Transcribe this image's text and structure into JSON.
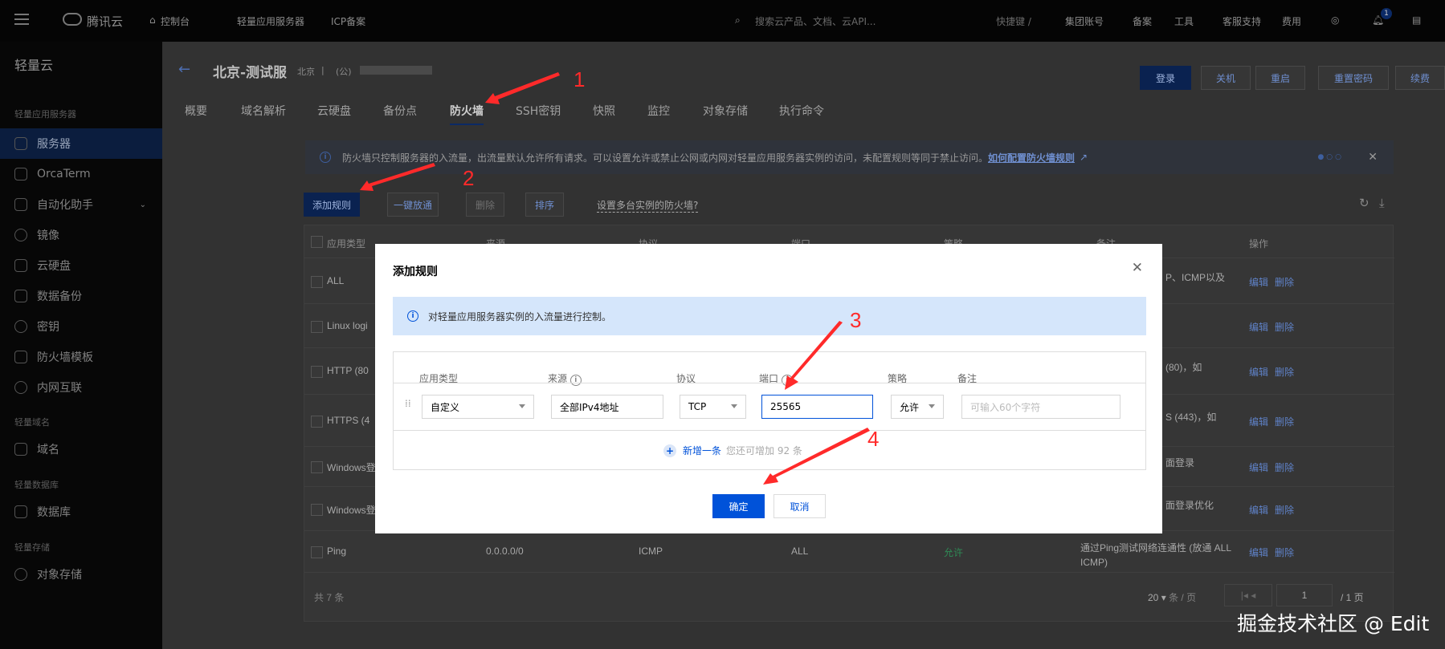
{
  "topbar": {
    "brand": "腾讯云",
    "console": "控制台",
    "nav": [
      "轻量应用服务器",
      "ICP备案"
    ],
    "search_placeholder": "搜索云产品、文档、云API...",
    "shortcut": "快捷键 /",
    "right": [
      "集团账号",
      "备案",
      "工具",
      "客服支持",
      "费用"
    ],
    "notif_count": "1"
  },
  "sidebar": {
    "title": "轻量云",
    "sections": [
      {
        "label": "轻量应用服务器",
        "items": [
          {
            "label": "服务器",
            "active": true
          },
          {
            "label": "OrcaTerm"
          },
          {
            "label": "自动化助手"
          },
          {
            "label": "镜像"
          },
          {
            "label": "云硬盘"
          },
          {
            "label": "数据备份"
          },
          {
            "label": "密钥"
          },
          {
            "label": "防火墙模板"
          },
          {
            "label": "内网互联"
          }
        ]
      },
      {
        "label": "轻量域名",
        "items": [
          {
            "label": "域名"
          }
        ]
      },
      {
        "label": "轻量数据库",
        "items": [
          {
            "label": "数据库"
          }
        ]
      },
      {
        "label": "轻量存储",
        "items": [
          {
            "label": "对象存储"
          }
        ]
      }
    ]
  },
  "header": {
    "title": "北京-测试服",
    "region": "北京",
    "ip_prefix": "(公)",
    "actions": [
      "登录",
      "关机",
      "重启",
      "重置密码",
      "续费"
    ]
  },
  "tabs": [
    "概要",
    "域名解析",
    "云硬盘",
    "备份点",
    "防火墙",
    "SSH密钥",
    "快照",
    "监控",
    "对象存储",
    "执行命令"
  ],
  "active_tab": "防火墙",
  "banner": {
    "text": "防火墙只控制服务器的入流量，出流量默认允许所有请求。可以设置允许或禁止公网或内网对轻量应用服务器实例的访问，未配置规则等同于禁止访问。",
    "link": "如何配置防火墙规则"
  },
  "toolbar": {
    "add": "添加规则",
    "open_all": "一键放通",
    "delete": "删除",
    "sort": "排序",
    "multi_link": "设置多台实例的防火墙?"
  },
  "table": {
    "headers": [
      "应用类型",
      "来源",
      "协议",
      "端口",
      "策略",
      "备注",
      "操作"
    ],
    "rows": [
      {
        "type": "ALL",
        "note": "P、ICMP以及"
      },
      {
        "type": "Linux logi",
        "note": ""
      },
      {
        "type": "HTTP (80",
        "note": "(80)，如"
      },
      {
        "type": "HTTPS (4",
        "note": "S (443)，如"
      },
      {
        "type": "Windows登",
        "note": "面登录"
      },
      {
        "type": "Windows登",
        "note": "面登录优化"
      },
      {
        "type": "Ping",
        "source": "0.0.0.0/0",
        "protocol": "ICMP",
        "port": "ALL",
        "policy": "允许",
        "note": "通过Ping测试网络连通性 (放通 ALL ICMP)"
      }
    ],
    "edit": "编辑",
    "remove": "删除",
    "total": "共 7 条",
    "page_size": "20",
    "per_page": "条 / 页",
    "page": "1",
    "pages": "/ 1 页"
  },
  "modal": {
    "title": "添加规则",
    "info": "对轻量应用服务器实例的入流量进行控制。",
    "headers": [
      "应用类型",
      "来源",
      "协议",
      "端口",
      "策略",
      "备注"
    ],
    "rule": {
      "type": "自定义",
      "source": "全部IPv4地址",
      "protocol": "TCP",
      "port": "25565",
      "policy": "允许",
      "note_placeholder": "可输入60个字符"
    },
    "add_row": "新增一条",
    "remaining": "您还可增加 92 条",
    "ok": "确定",
    "cancel": "取消"
  },
  "annotations": [
    "1",
    "2",
    "3",
    "4"
  ],
  "watermark": "掘金技术社区 @ Edit"
}
